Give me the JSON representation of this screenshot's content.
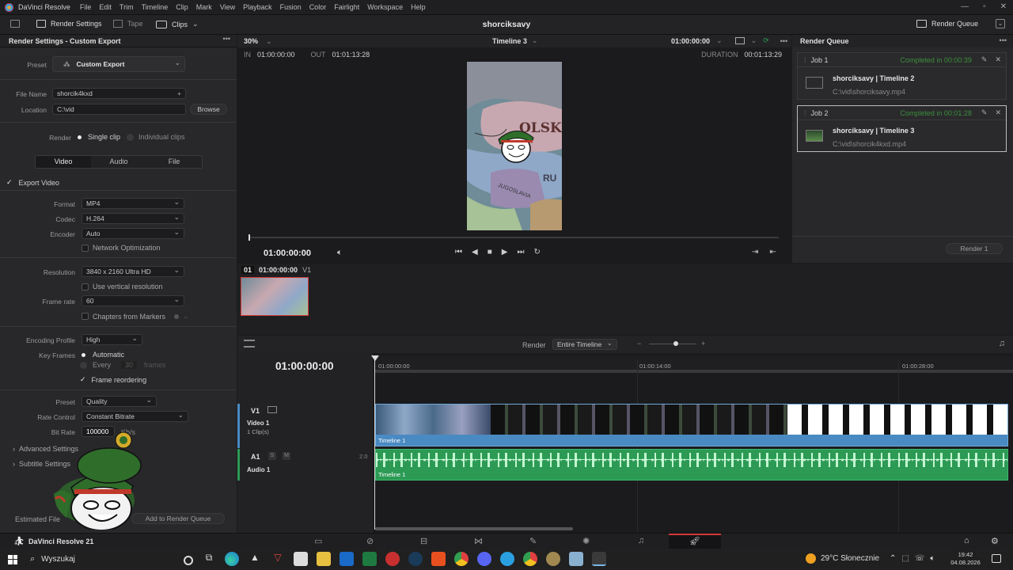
{
  "titlebar": {
    "app_name": "DaVinci Resolve",
    "menus": [
      "File",
      "Edit",
      "Trim",
      "Timeline",
      "Clip",
      "Mark",
      "View",
      "Playback",
      "Fusion",
      "Color",
      "Fairlight",
      "Workspace",
      "Help"
    ]
  },
  "toolbar": {
    "render_settings": "Render Settings",
    "tape": "Tape",
    "clips": "Clips",
    "project_title": "shorciksavy",
    "render_queue": "Render Queue"
  },
  "render_settings": {
    "header": "Render Settings - Custom Export",
    "preset_label": "Preset",
    "preset_value": "Custom Export",
    "file_name_label": "File Name",
    "file_name_value": "shorcik4kxd",
    "location_label": "Location",
    "location_value": "C:\\vid",
    "browse": "Browse",
    "render_label": "Render",
    "single_clip": "Single clip",
    "individual_clips": "Individual clips",
    "tabs": [
      "Video",
      "Audio",
      "File"
    ],
    "export_video": "Export Video",
    "format_label": "Format",
    "format_value": "MP4",
    "codec_label": "Codec",
    "codec_value": "H.264",
    "encoder_label": "Encoder",
    "encoder_value": "Auto",
    "network_opt": "Network Optimization",
    "resolution_label": "Resolution",
    "resolution_value": "3840 x 2160 Ultra HD",
    "vertical_res": "Use vertical resolution",
    "frame_rate_label": "Frame rate",
    "frame_rate_value": "60",
    "chapters": "Chapters from Markers",
    "enc_profile_label": "Encoding Profile",
    "enc_profile_value": "High",
    "key_frames_label": "Key Frames",
    "kf_auto": "Automatic",
    "kf_every": "Every",
    "kf_every_value": "30",
    "kf_frames": "frames",
    "frame_reorder": "Frame reordering",
    "preset2_label": "Preset",
    "preset2_value": "Quality",
    "rate_control_label": "Rate Control",
    "rate_control_value": "Constant Bitrate",
    "bitrate_label": "Bit Rate",
    "bitrate_value": "100000",
    "bitrate_unit": "Kb/s",
    "advanced": "Advanced Settings",
    "subtitle": "Subtitle Settings",
    "estimated": "Estimated File",
    "add_queue": "Add to Render Queue"
  },
  "viewer": {
    "zoom": "30%",
    "timeline_name": "Timeline 3",
    "timecode_top": "01:00:00:00",
    "in_label": "IN",
    "in_value": "01:00:00:00",
    "out_label": "OUT",
    "out_value": "01:01:13:28",
    "duration_label": "DURATION",
    "duration_value": "00:01:13:29",
    "current_tc": "01:00:00:00",
    "map_text1": "OLSK",
    "map_text2": "RU",
    "map_text3": "JUGOSLAVIA"
  },
  "clip_strip": {
    "index": "01",
    "timecode": "01:00:00:00",
    "track": "V1"
  },
  "render_queue": {
    "header": "Render Queue",
    "jobs": [
      {
        "name": "Job 1",
        "status": "Completed in 00:00:39",
        "title": "shorciksavy | Timeline 2",
        "path": "C:\\vid\\shorciksavy.mp4"
      },
      {
        "name": "Job 2",
        "status": "Completed in 00:01:28",
        "title": "shorciksavy | Timeline 3",
        "path": "C:\\vid\\shorcik4kxd.mp4"
      }
    ],
    "render_button": "Render 1"
  },
  "timeline": {
    "render_label": "Render",
    "render_value": "Entire Timeline",
    "big_tc": "01:00:00:00",
    "ruler": [
      "01:00:00:00",
      "01:00:14:00",
      "01:00:28:00"
    ],
    "v1_label": "V1",
    "video_track_name": "Video 1",
    "video_track_clips": "1 Clip(s)",
    "a1_label": "A1",
    "a_s": "S",
    "a_m": "M",
    "a_level": "2.0",
    "audio_track_name": "Audio 1",
    "video_clip_name": "Timeline 1",
    "audio_clip_name": "Timeline 1"
  },
  "pagebar": {
    "app_label": "DaVinci Resolve 21"
  },
  "taskbar": {
    "search": "Wyszukaj",
    "weather": "29°C  Słonecznie",
    "time": "19:42",
    "date": "04.08.2026"
  },
  "colors": {
    "accent_blue": "#4a8ac2",
    "audio_green": "#2c9a55",
    "completed_green": "#3d8f3d",
    "render_red": "#d43a3a"
  }
}
